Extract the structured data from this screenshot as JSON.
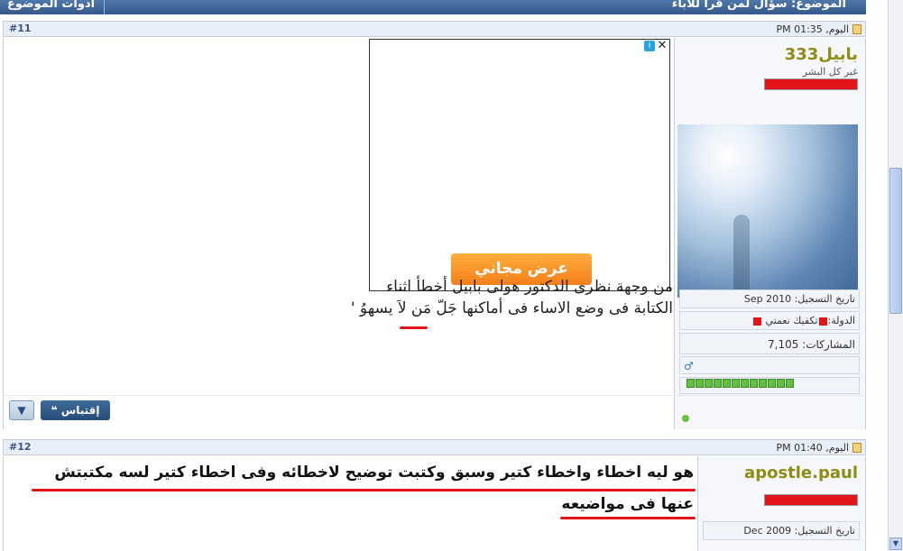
{
  "topbar": {
    "tools_label": "أدوات الموضوع ▼",
    "title": "الموضوع: سؤال لمن قرأ للأباء"
  },
  "posts": [
    {
      "number": "#11",
      "date": "اليوم, 01:35 PM",
      "username": "بابيل333",
      "user_title": "غير كل البشر",
      "reg_date": "تاريخ التسجيل: Sep 2010",
      "country": "الدولة:",
      "country_value": "تكفيك نعمتي",
      "posts_count": "المشاركات: 7,105",
      "ad": {
        "info": "i",
        "close": "✕",
        "cta": "عرض مجاني"
      },
      "text_lines": [
        "من وجهة نظرى الدكتور هولى بابيل أخطأ اثناء",
        "الكتابة فى وضع الاساء فى أماكنها جَلّ مَن لاَ يسهوُ '"
      ],
      "quote_label": "إقتباس",
      "menu_label": "▼"
    },
    {
      "number": "#12",
      "date": "اليوم, 01:40 PM",
      "username": "apostle.paul",
      "reg_date": "تاريخ التسجيل: Dec 2009",
      "text_lines": [
        "هو ليه اخطاء واخطاء كتير وسبق وكتبت توضيح لاخطائه وفى اخطاء كتير لسه مكتبتش",
        "عنها فى مواضيعه"
      ]
    }
  ],
  "colors": {
    "username": "#8e8c13",
    "highlight": "#e4141b",
    "header_bg": "#e8eef7",
    "topbar": "#34598a"
  }
}
